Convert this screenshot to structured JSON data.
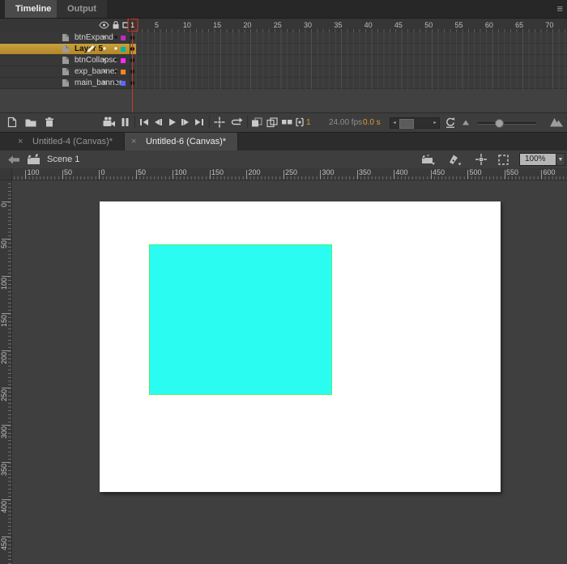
{
  "panel_tabs": {
    "timeline": "Timeline",
    "output": "Output"
  },
  "icons": {
    "menu": "≡",
    "close": "×",
    "x_mark": "×",
    "bullet": "•",
    "caret_down": "▼",
    "arrow_left": "◂",
    "arrow_right": "▸"
  },
  "timeline": {
    "playhead_frame": "1",
    "frame_numbers": [
      "1",
      "5",
      "10",
      "15",
      "20",
      "25",
      "30",
      "35",
      "40",
      "45",
      "50",
      "55",
      "60",
      "65",
      "70"
    ],
    "layers": [
      {
        "name": "btnExpand",
        "visible": false,
        "selected": false,
        "color": "#c428c4"
      },
      {
        "name": "Layer 5",
        "visible": true,
        "selected": true,
        "color": "#00b3a6"
      },
      {
        "name": "btnCollapse",
        "visible": false,
        "selected": false,
        "color": "#f42ef4"
      },
      {
        "name": "exp_banner",
        "visible": false,
        "selected": false,
        "color": "#f5871f"
      },
      {
        "name": "main_banner",
        "visible": false,
        "selected": false,
        "color": "#5968fa"
      }
    ],
    "status": {
      "current_frame": "1",
      "fps": "24.00 fps",
      "elapsed": "0.0 s"
    },
    "colors": {
      "selection_gold": "#c39431",
      "playhead_red": "#c23b30"
    }
  },
  "document_tabs": [
    {
      "label": "Untitled-4 (Canvas)*",
      "active": false
    },
    {
      "label": "Untitled-6 (Canvas)*",
      "active": true
    }
  ],
  "edit_bar": {
    "scene_label": "Scene 1",
    "zoom_value": "100%"
  },
  "rulers": {
    "horizontal": [
      "100",
      "50",
      "0",
      "50",
      "100",
      "150",
      "200",
      "250",
      "300",
      "350",
      "400",
      "450",
      "500",
      "550",
      "600"
    ],
    "vertical": [
      "0",
      "50",
      "100",
      "150",
      "200",
      "250",
      "300",
      "350",
      "400",
      "450"
    ]
  },
  "stage": {
    "fill": "#ffffff"
  },
  "shape": {
    "fill": "#2bfcf1",
    "stroke": "#49f26e"
  }
}
